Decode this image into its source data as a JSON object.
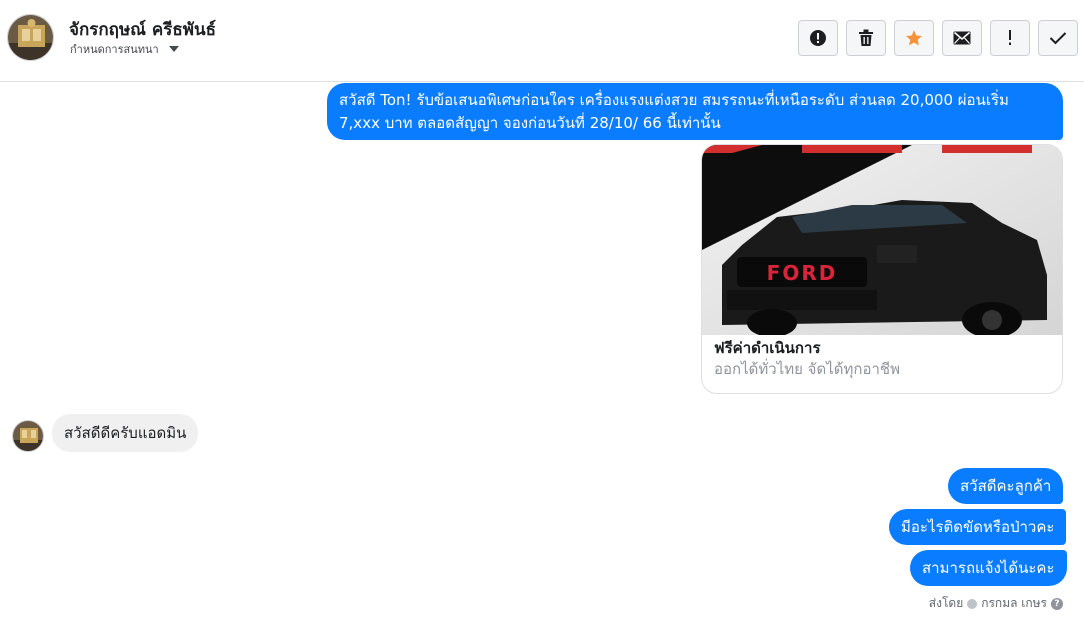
{
  "header": {
    "contact_name": "จักรกฤษณ์ ครีธพันธ์",
    "assign_label": "กำหนดการสนทนา",
    "actions": [
      {
        "icon": "alert-circle-icon"
      },
      {
        "icon": "trash-icon"
      },
      {
        "icon": "star-icon",
        "color": "#f7923a"
      },
      {
        "icon": "envelope-icon"
      },
      {
        "icon": "exclamation-icon"
      },
      {
        "icon": "checkmark-icon"
      }
    ]
  },
  "messages": {
    "promo_text": "สวัสดี Ton! รับข้อเสนอพิเศษก่อนใคร เครื่องแรงแต่งสวย สมรรถนะที่เหนือระดับ ส่วนลด 20,000 ผ่อนเริ่ม 7,xxx บาท ตลอดสัญญา จองก่อนวันที่ 28/10/ 66 นี้เท่านั้น",
    "card": {
      "image_text": "FORD",
      "title": "ฟรีค่าดำเนินการ",
      "subtitle": "ออกได้ทั่วไทย จัดได้ทุกอาชีพ"
    },
    "incoming_text": "สวัสดีดีครับแอดมิน",
    "reply1": "สวัสดีคะลูกค้า",
    "reply2": "มีอะไรติดขัดหรือป่าวคะ",
    "reply3": "สามารถแจ้งได้นะคะ",
    "sent_by_label": "ส่งโดย",
    "sent_by_name": "กรกมล เกษร",
    "help_glyph": "?"
  },
  "colors": {
    "outgoing_bubble": "#0a7cff",
    "incoming_bubble": "#f1f0f0",
    "star": "#f7923a"
  }
}
